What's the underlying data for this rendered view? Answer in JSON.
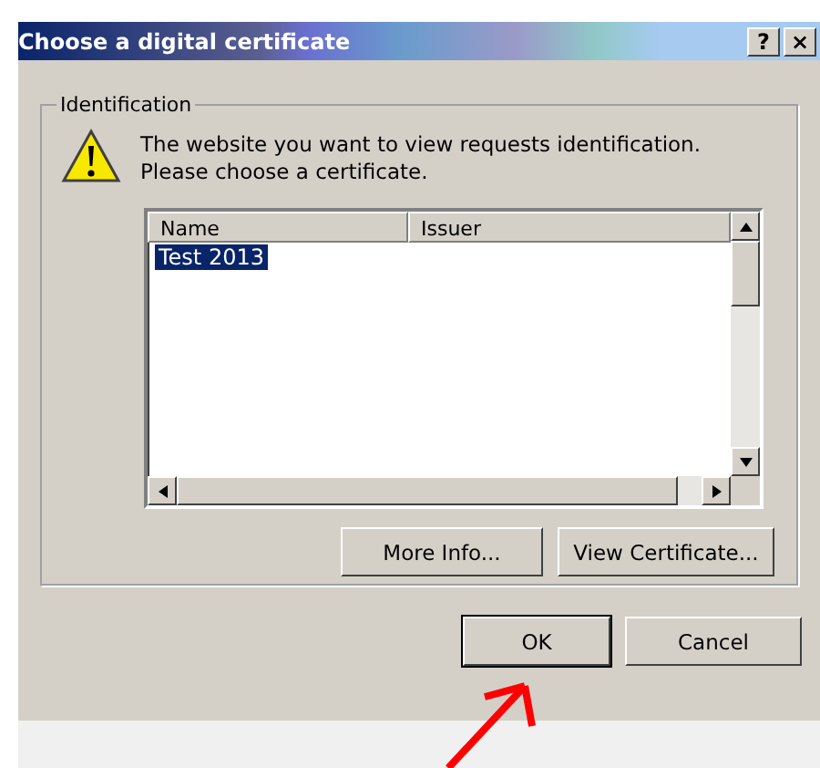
{
  "window": {
    "title": "Choose a digital certificate",
    "title_buttons": [
      "?",
      "×"
    ]
  },
  "group": {
    "label": "Identification",
    "message": "The website you want to view requests identification.\nPlease choose a certificate."
  },
  "list": {
    "columns": [
      "Name",
      "Issuer"
    ],
    "rows": [
      {
        "name": "Test 2013",
        "selected": true
      }
    ]
  },
  "list_buttons": [
    "More Info...",
    "View Certificate..."
  ],
  "buttons": [
    {
      "label": "OK",
      "default": true
    },
    {
      "label": "Cancel",
      "default": false
    }
  ]
}
